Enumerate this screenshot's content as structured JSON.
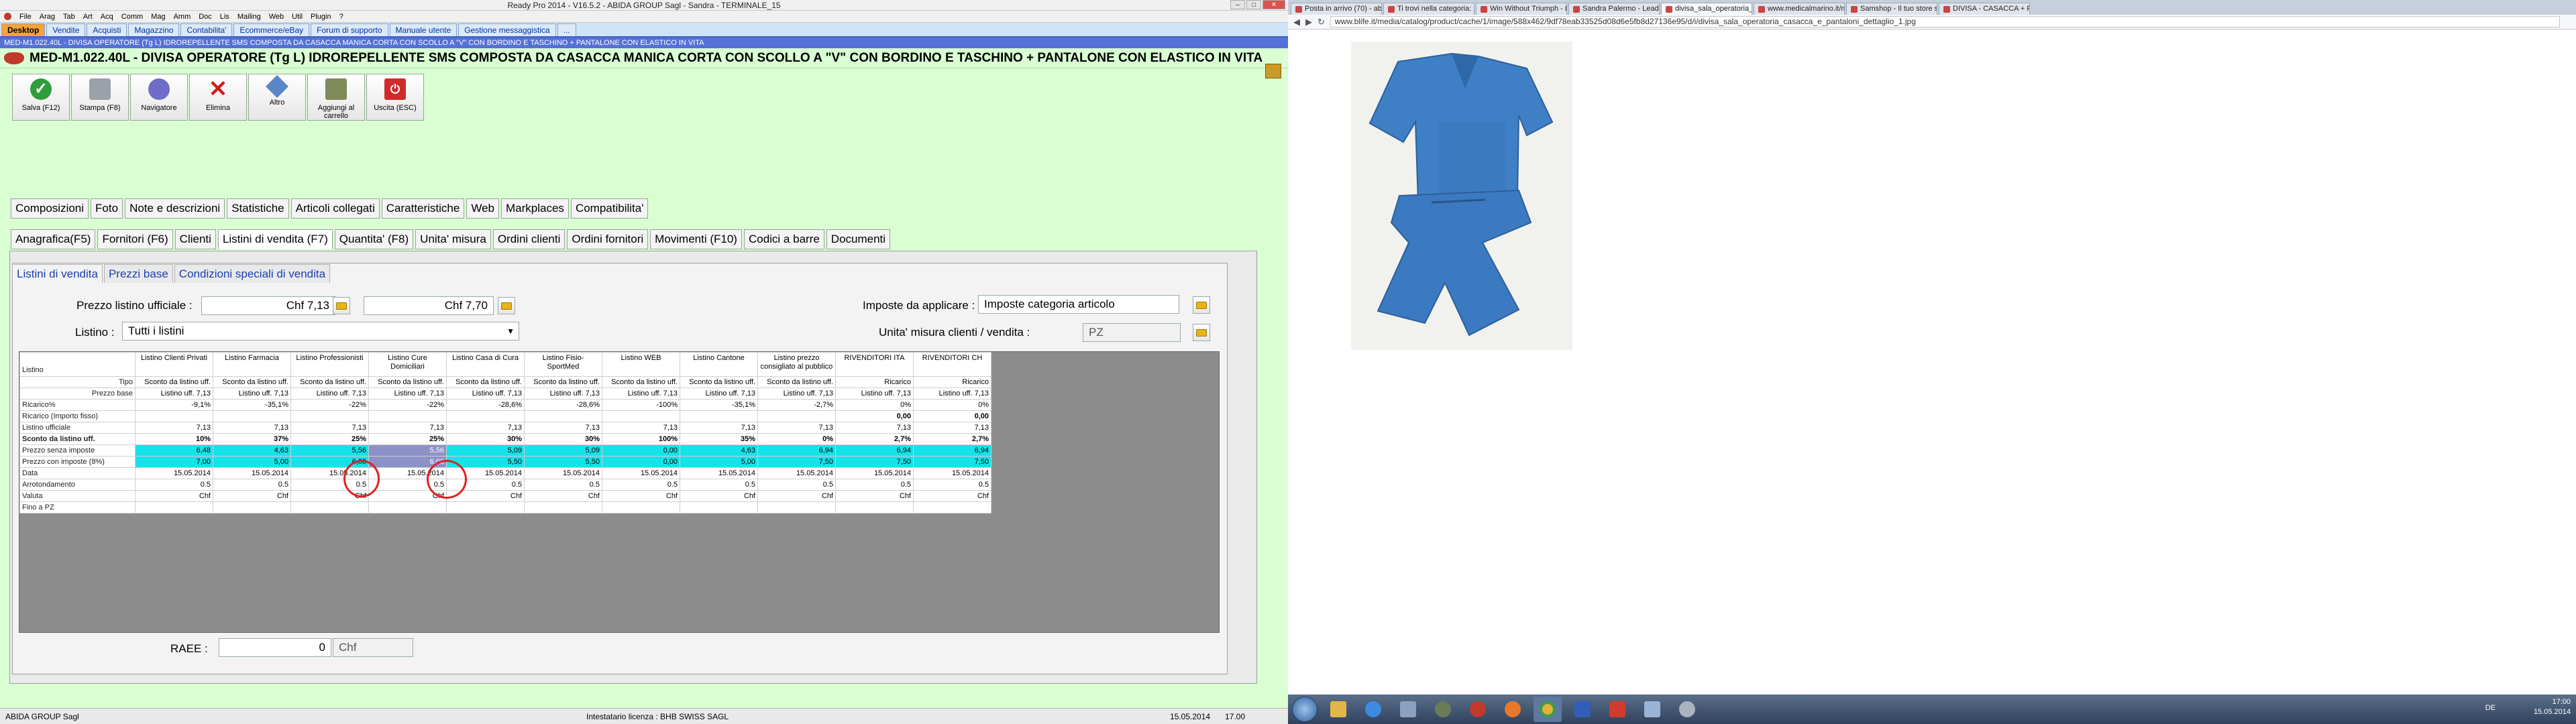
{
  "window": {
    "title": "Ready Pro 2014 - V16.5.2 - ABIDA GROUP Sagl - Sandra - TERMINALE_15"
  },
  "menubar": {
    "items": [
      "File",
      "Arag",
      "Tab",
      "Art",
      "Acq",
      "Comm",
      "Mag",
      "Amm",
      "Doc",
      "Lis",
      "Mailing",
      "Web",
      "Util",
      "Plugin",
      "?"
    ]
  },
  "apptabs": {
    "items": [
      "Desktop",
      "Vendite",
      "Acquisti",
      "Magazzino",
      "Contabilita'",
      "Ecommerce/eBay",
      "Forum di supporto",
      "Manuale utente",
      "Gestione messaggistica",
      "..."
    ]
  },
  "strip": {
    "text": "MED-M1.022.40L - DIVISA OPERATORE (Tg L) IDROREPELLENTE SMS COMPOSTA DA CASACCA MANICA CORTA CON SCOLLO A \"V\" CON BORDINO E TASCHINO + PANTALONE CON ELASTICO IN VITA"
  },
  "article": {
    "title": "MED-M1.022.40L - DIVISA OPERATORE (Tg L) IDROREPELLENTE SMS COMPOSTA DA CASACCA MANICA CORTA CON SCOLLO A \"V\" CON BORDINO E TASCHINO + PANTALONE CON ELASTICO IN VITA"
  },
  "toolbar": {
    "buttons": [
      "Salva (F12)",
      "Stampa (F8)",
      "Navigatore",
      "Elimina",
      "Altro",
      "Aggiungi al carrello",
      "Uscita (ESC)"
    ]
  },
  "sectionTabs": {
    "row1": [
      "Composizioni",
      "Foto",
      "Note e descrizioni",
      "Statistiche",
      "Articoli collegati",
      "Caratteristiche",
      "Web",
      "Markplaces",
      "Compatibilita'"
    ],
    "row2": [
      "Anagrafica(F5)",
      "Fornitori (F6)",
      "Clienti",
      "Listini di vendita (F7)",
      "Quantita' (F8)",
      "Unita' misura",
      "Ordini clienti",
      "Ordini fornitori",
      "Movimenti (F10)",
      "Codici a barre",
      "Documenti"
    ]
  },
  "subtabs": [
    "Listini di vendita",
    "Prezzi base",
    "Condizioni speciali di vendita"
  ],
  "form": {
    "prezzoListinoLabel": "Prezzo listino ufficiale :",
    "prezzo1": "Chf 7,13",
    "prezzo2": "Chf 7,70",
    "listinoLabel": "Listino :",
    "listinoValue": "Tutti i listini",
    "impLabel": "Imposte da applicare :",
    "impValue": "Imposte categoria articolo",
    "umLabel": "Unita' misura clienti / vendita :",
    "umValue": "PZ",
    "raeeLabel": "RAEE :",
    "raeeValue": "0",
    "raeeCurrency": "Chf"
  },
  "grid": {
    "headers": [
      "Listino",
      "Listino Clienti Privati",
      "Listino Farmacia",
      "Listino Professionisti",
      "Listino Cure Domiciliari",
      "Listino Casa di Cura",
      "Listino Fisio-SportMed",
      "Listino WEB",
      "Listino Cantone",
      "Listino prezzo consigliato al pubblico",
      "RIVENDITORI ITA",
      "RIVENDITORI CH"
    ],
    "rows": [
      [
        "Tipo",
        "Sconto da listino uff.",
        "Sconto da listino uff.",
        "Sconto da listino uff.",
        "Sconto da listino uff.",
        "Sconto da listino uff.",
        "Sconto da listino uff.",
        "Sconto da listino uff.",
        "Sconto da listino uff.",
        "Sconto da listino uff.",
        "Ricarico",
        "Ricarico"
      ],
      [
        "Prezzo base",
        "Listino uff. 7,13",
        "Listino uff. 7,13",
        "Listino uff. 7,13",
        "Listino uff. 7,13",
        "Listino uff. 7,13",
        "Listino uff. 7,13",
        "Listino uff. 7,13",
        "Listino uff. 7,13",
        "Listino uff. 7,13",
        "Listino uff. 7,13",
        "Listino uff. 7,13"
      ],
      [
        "Ricarico%",
        "-9,1%",
        "-35,1%",
        "-22%",
        "-22%",
        "-28,6%",
        "-28,6%",
        "-100%",
        "-35,1%",
        "-2,7%",
        "0%",
        "0%"
      ],
      [
        "Ricarico (Importo fisso)",
        "",
        "",
        "",
        "",
        "",
        "",
        "",
        "",
        "",
        "0,00",
        "0,00"
      ],
      [
        "Listino ufficiale",
        "7,13",
        "7,13",
        "7,13",
        "7,13",
        "7,13",
        "7,13",
        "7,13",
        "7,13",
        "7,13",
        "7,13",
        "7,13"
      ],
      [
        "Sconto da listino uff.",
        "10%",
        "37%",
        "25%",
        "25%",
        "30%",
        "30%",
        "100%",
        "35%",
        "0%",
        "2,7%",
        "2,7%"
      ],
      [
        "Prezzo senza imposte",
        "6,48",
        "4,63",
        "5,56",
        "5,56",
        "5,09",
        "5,09",
        "0,00",
        "4,63",
        "6,94",
        "6,94",
        "6,94"
      ],
      [
        "Prezzo con imposte (8%)",
        "7,00",
        "5,00",
        "6,00",
        "6,00",
        "5,50",
        "5,50",
        "0,00",
        "5,00",
        "7,50",
        "7,50",
        "7,50"
      ],
      [
        "Data",
        "15.05.2014",
        "15.05.2014",
        "15.05.2014",
        "15.05.2014",
        "15.05.2014",
        "15.05.2014",
        "15.05.2014",
        "15.05.2014",
        "15.05.2014",
        "15.05.2014",
        "15.05.2014"
      ],
      [
        "Arrotondamento",
        "0.5",
        "0.5",
        "0.5",
        "0.5",
        "0.5",
        "0.5",
        "0.5",
        "0.5",
        "0.5",
        "0.5",
        "0.5"
      ],
      [
        "Valuta",
        "Chf",
        "Chf",
        "Chf",
        "Chf",
        "Chf",
        "Chf",
        "Chf",
        "Chf",
        "Chf",
        "Chf",
        "Chf"
      ],
      [
        "Fino a PZ",
        "",
        "",
        "",
        "",
        "",
        "",
        "",
        "",
        "",
        "",
        ""
      ]
    ]
  },
  "status": {
    "left": "ABIDA GROUP Sagl",
    "center": "Intestatario licenza : BHB SWISS SAGL",
    "date": "15.05.2014",
    "time": "17.00"
  },
  "browser": {
    "tabs": [
      "Posta in arrivo (70) - abida",
      "Ti trovi nella categoria: 2",
      "Win Without Triumph - L",
      "Sandra Palermo - Leads",
      "divisa_sala_operatoria_ca",
      "www.medicalmarino.it/ma",
      "Samshop - Il tuo store sa",
      "DIVISA - CASACCA + PAN"
    ],
    "url": "www.blife.it/media/catalog/product/cache/1/image/588x462/9df78eab33525d08d6e5fb8d27136e95/d/i/divisa_sala_operatoria_casacca_e_pantaloni_dettaglio_1.jpg"
  },
  "taskbar": {
    "lang": "DE",
    "time": "17:00",
    "date": "15.05.2014"
  }
}
